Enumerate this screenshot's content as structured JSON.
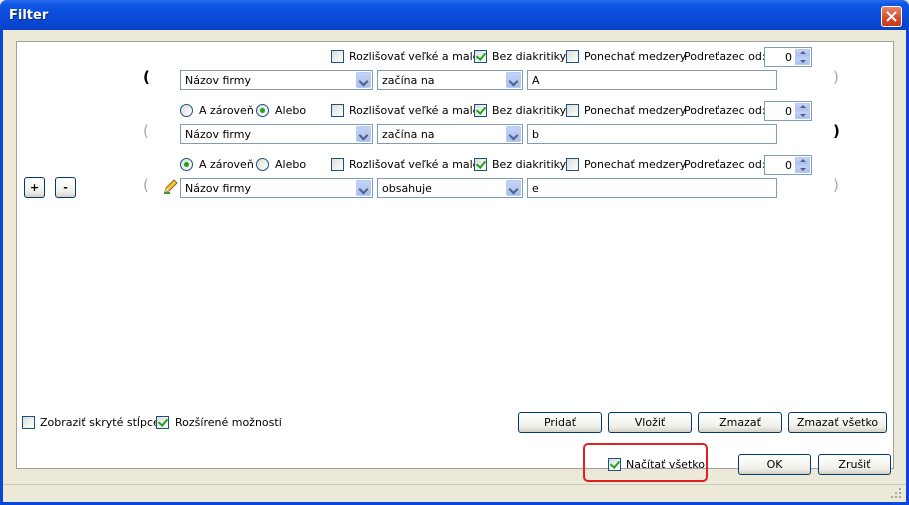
{
  "window": {
    "title": "Filter"
  },
  "rows": [
    {
      "connector": null,
      "options": {
        "case_label": "Rozlišovať veľké a malé",
        "case_checked": false,
        "diacritics_label": "Bez diakritiky",
        "diacritics_checked": true,
        "spaces_label": "Ponechať medzery",
        "spaces_checked": false,
        "substring_label": "Podreťazec od:",
        "substring_value": "0"
      },
      "open_paren": "(",
      "close_paren": ")",
      "field": "Názov firmy",
      "operator": "začína na",
      "value": "A"
    },
    {
      "connector": {
        "and_label": "A zároveň",
        "or_label": "Alebo",
        "selected": "or"
      },
      "options": {
        "case_label": "Rozlišovať veľké a malé",
        "case_checked": false,
        "diacritics_label": "Bez diakritiky",
        "diacritics_checked": true,
        "spaces_label": "Ponechať medzery",
        "spaces_checked": false,
        "substring_label": "Podreťazec od:",
        "substring_value": "0"
      },
      "open_paren": "(",
      "close_paren": ")",
      "field": "Názov firmy",
      "operator": "začína na",
      "value": "b"
    },
    {
      "connector": {
        "and_label": "A zároveň",
        "or_label": "Alebo",
        "selected": "and"
      },
      "options": {
        "case_label": "Rozlišovať veľké a malé",
        "case_checked": false,
        "diacritics_label": "Bez diakritiky",
        "diacritics_checked": true,
        "spaces_label": "Ponechať medzery",
        "spaces_checked": false,
        "substring_label": "Podreťazec od:",
        "substring_value": "0"
      },
      "open_paren": "(",
      "close_paren": ")",
      "field": "Názov firmy",
      "operator": "obsahuje",
      "value": "e"
    }
  ],
  "paren_buttons": {
    "add": "+",
    "remove": "-"
  },
  "bottom_options": {
    "show_hidden_label": "Zobraziť skryté stĺpce",
    "show_hidden_checked": false,
    "advanced_label": "Rozšírené možnosti",
    "advanced_checked": true
  },
  "actions": {
    "add": "Pridať",
    "insert": "Vložiť",
    "delete": "Zmazať",
    "delete_all": "Zmazať všetko"
  },
  "footer": {
    "load_all_label": "Načítať všetko",
    "load_all_checked": true,
    "ok": "OK",
    "cancel": "Zrušiť"
  },
  "colors": {
    "titlebar": "#0a4ad6",
    "highlight": "#e02020",
    "check": "#21a121"
  }
}
